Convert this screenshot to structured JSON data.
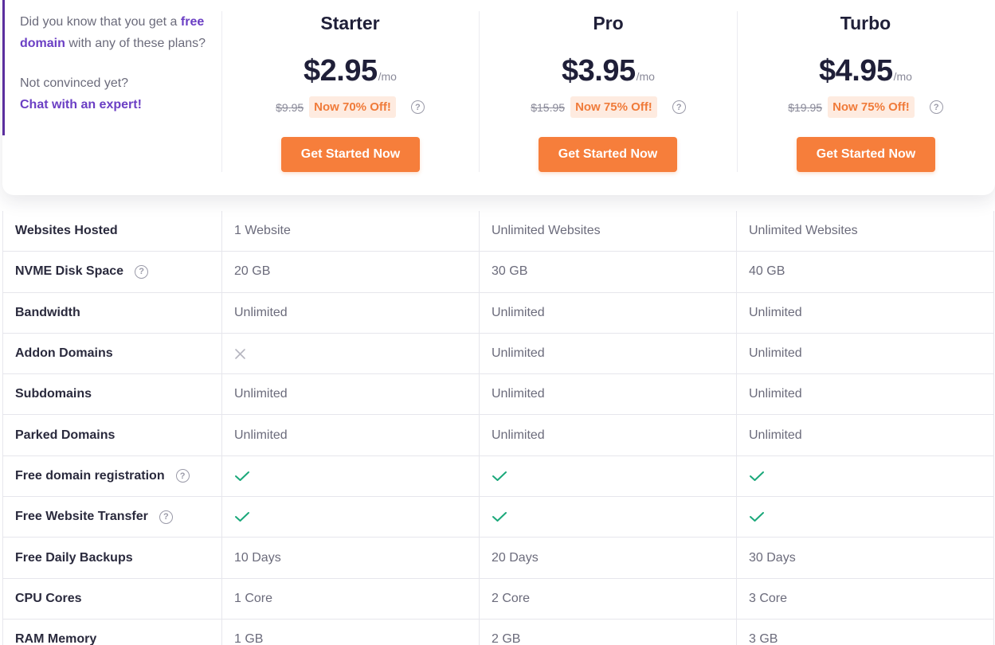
{
  "intro": {
    "line1_pre": "Did you know that you get a",
    "line1_link": "free domain",
    "line1_post": "with any of these plans?",
    "line2_text": "Not convinced yet?",
    "line2_link": "Chat with an expert!"
  },
  "plans": [
    {
      "name": "Starter",
      "price": "$2.95",
      "per": "/mo",
      "old_price": "$9.95",
      "badge": "Now 70% Off!",
      "cta": "Get Started Now"
    },
    {
      "name": "Pro",
      "price": "$3.95",
      "per": "/mo",
      "old_price": "$15.95",
      "badge": "Now 75% Off!",
      "cta": "Get Started Now"
    },
    {
      "name": "Turbo",
      "price": "$4.95",
      "per": "/mo",
      "old_price": "$19.95",
      "badge": "Now 75% Off!",
      "cta": "Get Started Now"
    }
  ],
  "help_glyph": "?",
  "features": [
    {
      "label": "Websites Hosted",
      "help": false,
      "values": [
        "1 Website",
        "Unlimited Websites",
        "Unlimited Websites"
      ]
    },
    {
      "label": "NVME Disk Space",
      "help": true,
      "values": [
        "20 GB",
        "30 GB",
        "40 GB"
      ]
    },
    {
      "label": "Bandwidth",
      "help": false,
      "values": [
        "Unlimited",
        "Unlimited",
        "Unlimited"
      ]
    },
    {
      "label": "Addon Domains",
      "help": false,
      "values": [
        "cross-icon",
        "Unlimited",
        "Unlimited"
      ]
    },
    {
      "label": "Subdomains",
      "help": false,
      "values": [
        "Unlimited",
        "Unlimited",
        "Unlimited"
      ]
    },
    {
      "label": "Parked Domains",
      "help": false,
      "values": [
        "Unlimited",
        "Unlimited",
        "Unlimited"
      ]
    },
    {
      "label": "Free domain registration",
      "help": true,
      "values": [
        "check-icon",
        "check-icon",
        "check-icon"
      ]
    },
    {
      "label": "Free Website Transfer",
      "help": true,
      "values": [
        "check-icon",
        "check-icon",
        "check-icon"
      ]
    },
    {
      "label": "Free Daily Backups",
      "help": false,
      "values": [
        "10 Days",
        "20 Days",
        "30 Days"
      ]
    },
    {
      "label": "CPU Cores",
      "help": false,
      "values": [
        "1 Core",
        "2 Core",
        "3 Core"
      ]
    },
    {
      "label": "RAM Memory",
      "help": false,
      "values": [
        "1 GB",
        "2 GB",
        "3 GB"
      ]
    }
  ],
  "colors": {
    "accent": "#6b3fc4",
    "cta": "#f67e3b",
    "badge_bg": "#feebe0",
    "badge_text": "#f07b3a",
    "check": "#1aa87a"
  }
}
